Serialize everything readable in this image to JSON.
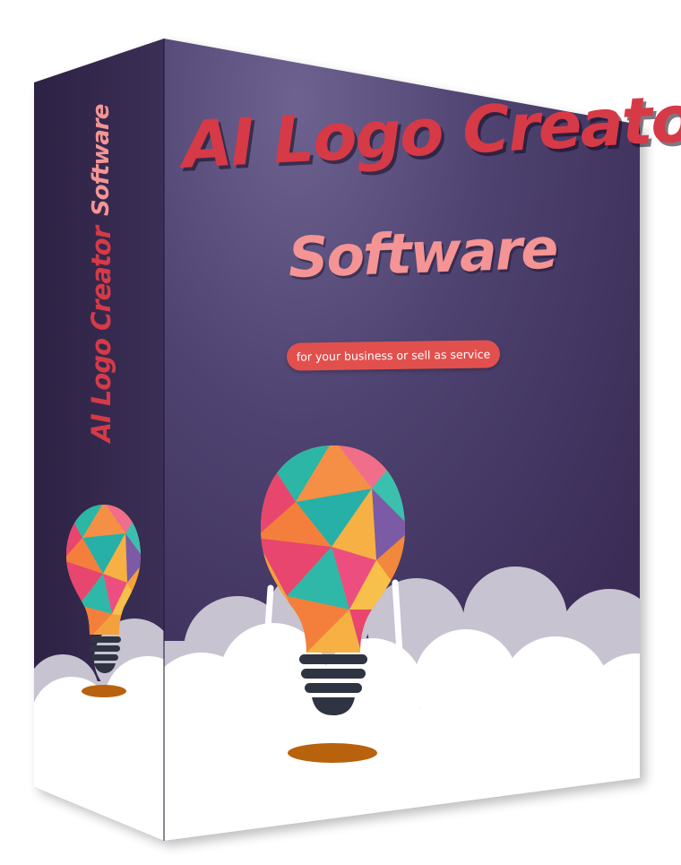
{
  "product": {
    "front": {
      "title": "AI Logo Creator",
      "subtitle": "Software",
      "tagline": "for your business or sell as service"
    },
    "spine": {
      "title": "AI Logo Creator",
      "subtitle": "Software"
    }
  },
  "colors": {
    "title_red": "#d63a46",
    "subtitle_pink": "#f49494",
    "tagline_pill": "#e2504e",
    "box_purple_light": "#6d6290",
    "box_purple_dark": "#3a2c56",
    "cloud_white": "#ffffff",
    "cloud_shadow": "#c7c3d0",
    "bulb_base": "#2e3442",
    "shadow_orange": "#b8620e"
  },
  "icons": {
    "main": "lightbulb-icon",
    "spine": "lightbulb-icon"
  }
}
